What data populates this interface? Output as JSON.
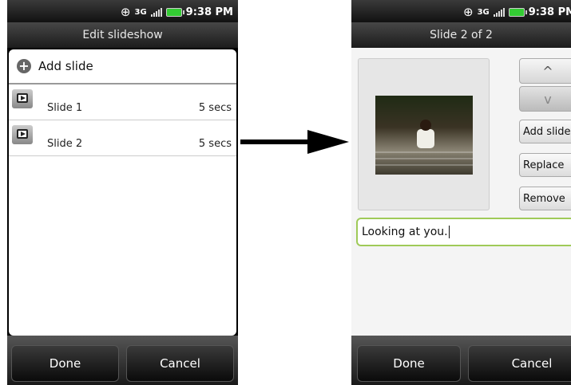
{
  "status": {
    "network": "3G",
    "time": "9:38 PM"
  },
  "left": {
    "title": "Edit slideshow",
    "add_slide": "Add slide",
    "slides": [
      {
        "name": "Slide 1",
        "duration": "5 secs"
      },
      {
        "name": "Slide 2",
        "duration": "5 secs"
      }
    ],
    "done": "Done",
    "cancel": "Cancel"
  },
  "right": {
    "title": "Slide 2 of 2",
    "up_arrow": "^",
    "down_arrow": "v",
    "add_slide": "Add slide",
    "replace": "Replace",
    "remove": "Remove",
    "caption": "Looking at you.",
    "done": "Done",
    "cancel": "Cancel"
  }
}
